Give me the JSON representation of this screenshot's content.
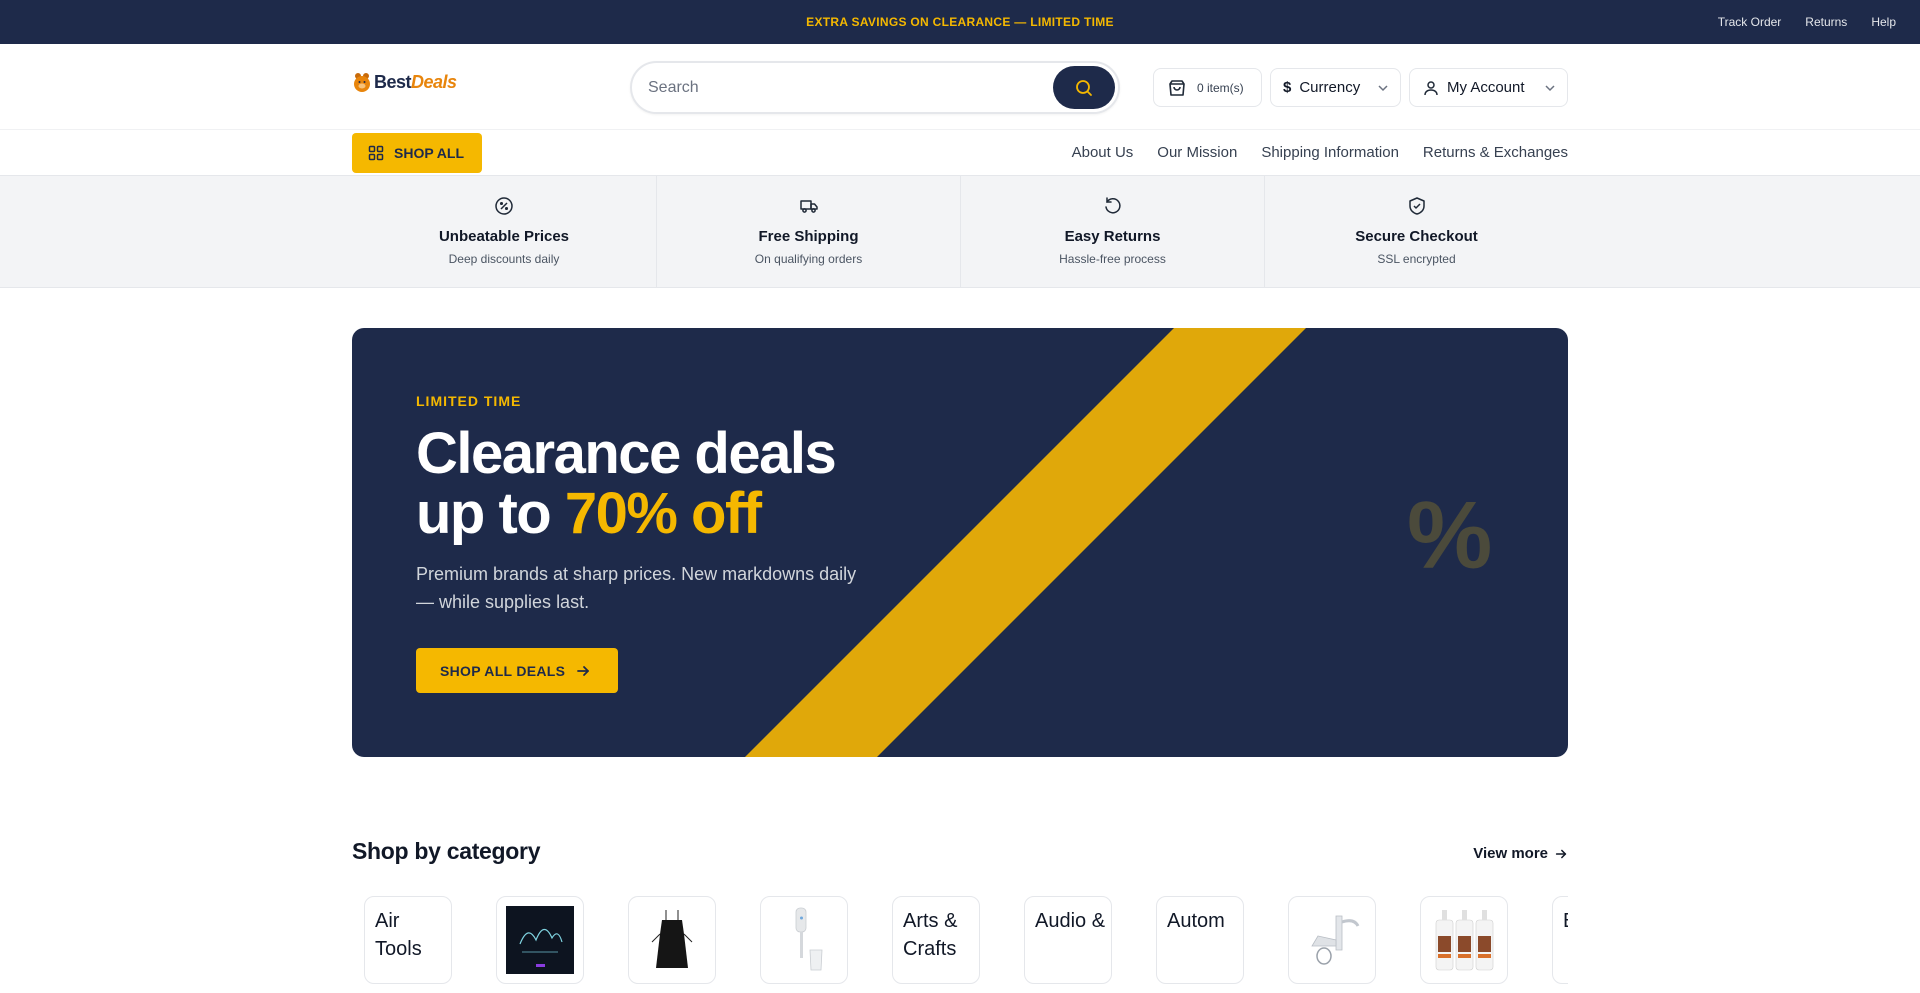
{
  "topbar": {
    "promo": "EXTRA SAVINGS ON CLEARANCE — LIMITED TIME",
    "links": [
      "Track Order",
      "Returns",
      "Help"
    ]
  },
  "header": {
    "logo_best": "Best",
    "logo_deals": "Deals",
    "search_placeholder": "Search",
    "cart_count": "0 item(s)",
    "currency_symbol": "$",
    "currency_label": "Currency",
    "account_label": "My Account"
  },
  "nav": {
    "shop_all": "SHOP ALL",
    "links": [
      "About Us",
      "Our Mission",
      "Shipping Information",
      "Returns & Exchanges"
    ]
  },
  "features": [
    {
      "title": "Unbeatable Prices",
      "subtitle": "Deep discounts daily",
      "icon": "discount-icon"
    },
    {
      "title": "Free Shipping",
      "subtitle": "On qualifying orders",
      "icon": "truck-icon"
    },
    {
      "title": "Easy Returns",
      "subtitle": "Hassle-free process",
      "icon": "return-icon"
    },
    {
      "title": "Secure Checkout",
      "subtitle": "SSL encrypted",
      "icon": "shield-icon"
    }
  ],
  "hero": {
    "eyebrow": "LIMITED TIME",
    "headline_line1": "Clearance deals",
    "headline_line2_prefix": "up to ",
    "headline_accent": "70% off",
    "subtext": "Premium brands at sharp prices. New markdowns daily — while supplies last.",
    "cta": "SHOP ALL DEALS",
    "decor_symbol": "%"
  },
  "categories": {
    "title": "Shop by category",
    "view_more": "View more",
    "items": [
      {
        "alt": "Air Tools",
        "kind": "broken"
      },
      {
        "alt": "",
        "kind": "poster"
      },
      {
        "alt": "",
        "kind": "apron"
      },
      {
        "alt": "",
        "kind": "blender"
      },
      {
        "alt": "Arts & Crafts",
        "kind": "broken"
      },
      {
        "alt": "Audio &",
        "kind": "broken"
      },
      {
        "alt": "Autom",
        "kind": "broken"
      },
      {
        "alt": "",
        "kind": "faucet"
      },
      {
        "alt": "",
        "kind": "bottles"
      },
      {
        "alt": "B",
        "kind": "broken"
      }
    ]
  },
  "colors": {
    "navy": "#1e2a4a",
    "yellow": "#f5b800",
    "logo_orange": "#e8850c"
  }
}
